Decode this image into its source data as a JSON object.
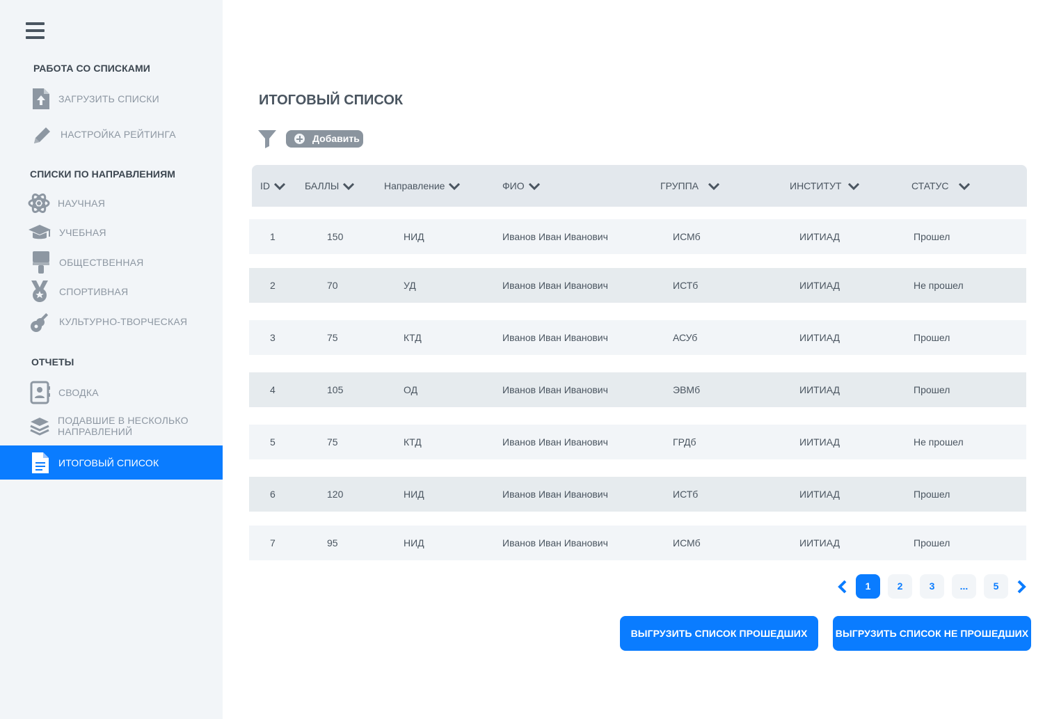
{
  "sidebar": {
    "sections": [
      {
        "title": "РАБОТА СО СПИСКАМИ"
      },
      {
        "title": "СПИСКИ ПО НАПРАВЛЕНИЯМ"
      },
      {
        "title": "ОТЧЕТЫ"
      }
    ],
    "items": [
      {
        "label": "ЗАГРУЗИТЬ СПИСКИ",
        "icon": "file-upload-icon"
      },
      {
        "label": "НАСТРОЙКА РЕЙТИНГА",
        "icon": "pencil-icon"
      },
      {
        "label": "НАУЧНАЯ",
        "icon": "atom-icon"
      },
      {
        "label": "УЧЕБНАЯ",
        "icon": "graduation-cap-icon"
      },
      {
        "label": "ОБЩЕСТВЕННАЯ",
        "icon": "paint-brush-icon"
      },
      {
        "label": "СПОРТИВНАЯ",
        "icon": "medal-icon"
      },
      {
        "label": "КУЛЬТУРНО-ТВОРЧЕСКАЯ",
        "icon": "guitar-icon"
      },
      {
        "label": "СВОДКА",
        "icon": "contact-card-icon"
      },
      {
        "label": "ПОДАВШИЕ В НЕСКОЛЬКО НАПРАВЛЕНИЙ",
        "icon": "layers-icon"
      },
      {
        "label": "ИТОГОВЫЙ СПИСОК",
        "icon": "document-icon",
        "active": true
      }
    ]
  },
  "main": {
    "title": "ИТОГОВЫЙ СПИСОК",
    "add_label": "Добавить",
    "columns": [
      "ID",
      "БАЛЛЫ",
      "Направление",
      "ФИО",
      "ГРУППА",
      "ИНСТИТУТ",
      "СТАТУС"
    ],
    "rows": [
      [
        "1",
        "150",
        "НИД",
        "Иванов Иван Иванович",
        "ИСМб",
        "ИИТИАД",
        "Прошел"
      ],
      [
        "2",
        "70",
        "УД",
        "Иванов Иван Иванович",
        "ИСТб",
        "ИИТИАД",
        "Не прошел"
      ],
      [
        "3",
        "75",
        "КТД",
        "Иванов Иван Иванович",
        "АСУб",
        "ИИТИАД",
        "Прошел"
      ],
      [
        "4",
        "105",
        "ОД",
        "Иванов Иван Иванович",
        "ЭВМб",
        "ИИТИАД",
        "Прошел"
      ],
      [
        "5",
        "75",
        "КТД",
        "Иванов Иван Иванович",
        "ГРДб",
        "ИИТИАД",
        "Не прошел"
      ],
      [
        "6",
        "120",
        "НИД",
        "Иванов Иван Иванович",
        "ИСТб",
        "ИИТИАД",
        "Прошел"
      ],
      [
        "7",
        "95",
        "НИД",
        "Иванов Иван Иванович",
        "ИСМб",
        "ИИТИАД",
        "Прошел"
      ]
    ],
    "pagination": {
      "pages": [
        "1",
        "2",
        "3",
        "...",
        "5"
      ],
      "current": "1"
    },
    "export_passed": "ВЫГРУЗИТЬ СПИСОК ПРОШЕДШИХ",
    "export_failed": "ВЫГРУЗИТЬ СПИСОК НЕ ПРОШЕДШИХ"
  },
  "colors": {
    "accent": "#0a7cff",
    "sidebar_bg": "#f2f5f8",
    "muted_text": "#8d97a2"
  }
}
